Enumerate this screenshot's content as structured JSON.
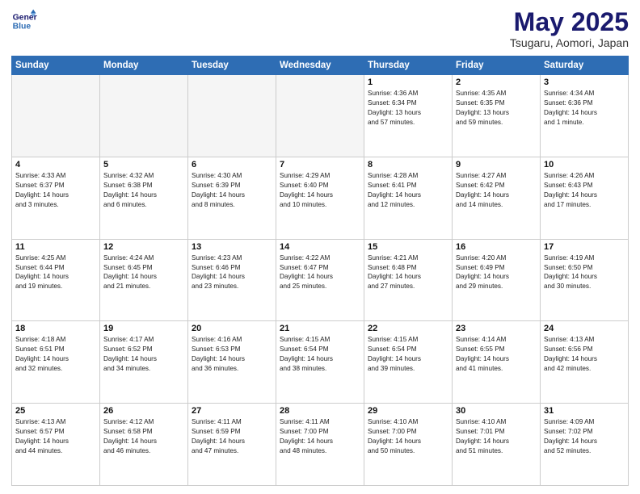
{
  "logo": {
    "line1": "General",
    "line2": "Blue"
  },
  "title": "May 2025",
  "location": "Tsugaru, Aomori, Japan",
  "days_of_week": [
    "Sunday",
    "Monday",
    "Tuesday",
    "Wednesday",
    "Thursday",
    "Friday",
    "Saturday"
  ],
  "weeks": [
    [
      {
        "day": "",
        "info": ""
      },
      {
        "day": "",
        "info": ""
      },
      {
        "day": "",
        "info": ""
      },
      {
        "day": "",
        "info": ""
      },
      {
        "day": "1",
        "info": "Sunrise: 4:36 AM\nSunset: 6:34 PM\nDaylight: 13 hours\nand 57 minutes."
      },
      {
        "day": "2",
        "info": "Sunrise: 4:35 AM\nSunset: 6:35 PM\nDaylight: 13 hours\nand 59 minutes."
      },
      {
        "day": "3",
        "info": "Sunrise: 4:34 AM\nSunset: 6:36 PM\nDaylight: 14 hours\nand 1 minute."
      }
    ],
    [
      {
        "day": "4",
        "info": "Sunrise: 4:33 AM\nSunset: 6:37 PM\nDaylight: 14 hours\nand 3 minutes."
      },
      {
        "day": "5",
        "info": "Sunrise: 4:32 AM\nSunset: 6:38 PM\nDaylight: 14 hours\nand 6 minutes."
      },
      {
        "day": "6",
        "info": "Sunrise: 4:30 AM\nSunset: 6:39 PM\nDaylight: 14 hours\nand 8 minutes."
      },
      {
        "day": "7",
        "info": "Sunrise: 4:29 AM\nSunset: 6:40 PM\nDaylight: 14 hours\nand 10 minutes."
      },
      {
        "day": "8",
        "info": "Sunrise: 4:28 AM\nSunset: 6:41 PM\nDaylight: 14 hours\nand 12 minutes."
      },
      {
        "day": "9",
        "info": "Sunrise: 4:27 AM\nSunset: 6:42 PM\nDaylight: 14 hours\nand 14 minutes."
      },
      {
        "day": "10",
        "info": "Sunrise: 4:26 AM\nSunset: 6:43 PM\nDaylight: 14 hours\nand 17 minutes."
      }
    ],
    [
      {
        "day": "11",
        "info": "Sunrise: 4:25 AM\nSunset: 6:44 PM\nDaylight: 14 hours\nand 19 minutes."
      },
      {
        "day": "12",
        "info": "Sunrise: 4:24 AM\nSunset: 6:45 PM\nDaylight: 14 hours\nand 21 minutes."
      },
      {
        "day": "13",
        "info": "Sunrise: 4:23 AM\nSunset: 6:46 PM\nDaylight: 14 hours\nand 23 minutes."
      },
      {
        "day": "14",
        "info": "Sunrise: 4:22 AM\nSunset: 6:47 PM\nDaylight: 14 hours\nand 25 minutes."
      },
      {
        "day": "15",
        "info": "Sunrise: 4:21 AM\nSunset: 6:48 PM\nDaylight: 14 hours\nand 27 minutes."
      },
      {
        "day": "16",
        "info": "Sunrise: 4:20 AM\nSunset: 6:49 PM\nDaylight: 14 hours\nand 29 minutes."
      },
      {
        "day": "17",
        "info": "Sunrise: 4:19 AM\nSunset: 6:50 PM\nDaylight: 14 hours\nand 30 minutes."
      }
    ],
    [
      {
        "day": "18",
        "info": "Sunrise: 4:18 AM\nSunset: 6:51 PM\nDaylight: 14 hours\nand 32 minutes."
      },
      {
        "day": "19",
        "info": "Sunrise: 4:17 AM\nSunset: 6:52 PM\nDaylight: 14 hours\nand 34 minutes."
      },
      {
        "day": "20",
        "info": "Sunrise: 4:16 AM\nSunset: 6:53 PM\nDaylight: 14 hours\nand 36 minutes."
      },
      {
        "day": "21",
        "info": "Sunrise: 4:15 AM\nSunset: 6:54 PM\nDaylight: 14 hours\nand 38 minutes."
      },
      {
        "day": "22",
        "info": "Sunrise: 4:15 AM\nSunset: 6:54 PM\nDaylight: 14 hours\nand 39 minutes."
      },
      {
        "day": "23",
        "info": "Sunrise: 4:14 AM\nSunset: 6:55 PM\nDaylight: 14 hours\nand 41 minutes."
      },
      {
        "day": "24",
        "info": "Sunrise: 4:13 AM\nSunset: 6:56 PM\nDaylight: 14 hours\nand 42 minutes."
      }
    ],
    [
      {
        "day": "25",
        "info": "Sunrise: 4:13 AM\nSunset: 6:57 PM\nDaylight: 14 hours\nand 44 minutes."
      },
      {
        "day": "26",
        "info": "Sunrise: 4:12 AM\nSunset: 6:58 PM\nDaylight: 14 hours\nand 46 minutes."
      },
      {
        "day": "27",
        "info": "Sunrise: 4:11 AM\nSunset: 6:59 PM\nDaylight: 14 hours\nand 47 minutes."
      },
      {
        "day": "28",
        "info": "Sunrise: 4:11 AM\nSunset: 7:00 PM\nDaylight: 14 hours\nand 48 minutes."
      },
      {
        "day": "29",
        "info": "Sunrise: 4:10 AM\nSunset: 7:00 PM\nDaylight: 14 hours\nand 50 minutes."
      },
      {
        "day": "30",
        "info": "Sunrise: 4:10 AM\nSunset: 7:01 PM\nDaylight: 14 hours\nand 51 minutes."
      },
      {
        "day": "31",
        "info": "Sunrise: 4:09 AM\nSunset: 7:02 PM\nDaylight: 14 hours\nand 52 minutes."
      }
    ]
  ]
}
